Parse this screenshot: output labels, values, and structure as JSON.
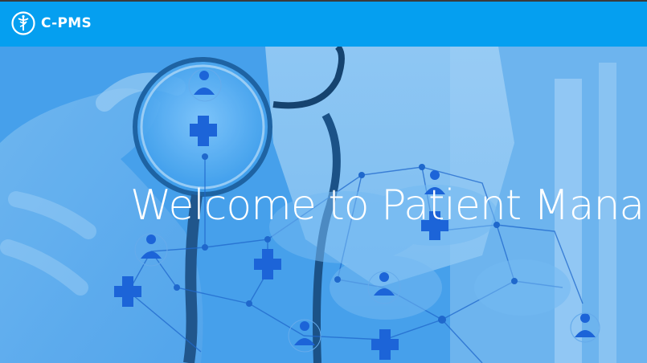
{
  "navbar": {
    "brand_name": "C-PMS",
    "brand_icon": "caduceus-icon",
    "background_color": "#059ff0"
  },
  "hero": {
    "headline": "Welcome to Patient Manage",
    "overlay_color": "#3c9ae8",
    "background_image": "doctor-stethoscope-network-photo"
  }
}
